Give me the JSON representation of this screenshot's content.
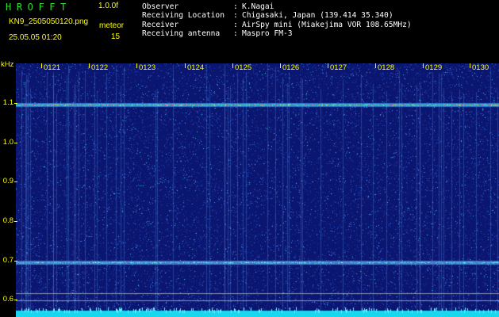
{
  "header": {
    "app_title": "HROFFT",
    "app_version": "1.0.0f",
    "file_name": "KN9_2505050120.png",
    "datetime": "25.05.05 01:20",
    "mode_label": "meteor",
    "mode_value": "15",
    "info": [
      {
        "key": "Observer",
        "value": "K.Nagai"
      },
      {
        "key": "Receiving Location",
        "value": "Chigasaki, Japan (139.414 35.340)"
      },
      {
        "key": "Receiver",
        "value": "AirSpy mini (Miakejima VOR 108.65MHz)"
      },
      {
        "key": "Receiving antenna",
        "value": "Maspro FM-3"
      }
    ]
  },
  "axes": {
    "y_unit": "kHz",
    "y_labels": [
      "1.1",
      "1.0",
      "0.9",
      "0.8",
      "0.7",
      "0.6"
    ],
    "x_labels": [
      "0121",
      "0122",
      "0123",
      "0124",
      "0125",
      "0126",
      "0127",
      "0128",
      "0129",
      "0130"
    ]
  },
  "colors": {
    "background": "#0b1670",
    "label": "#ffff00",
    "title": "#33dd33",
    "info_text": "#ffffff"
  }
}
